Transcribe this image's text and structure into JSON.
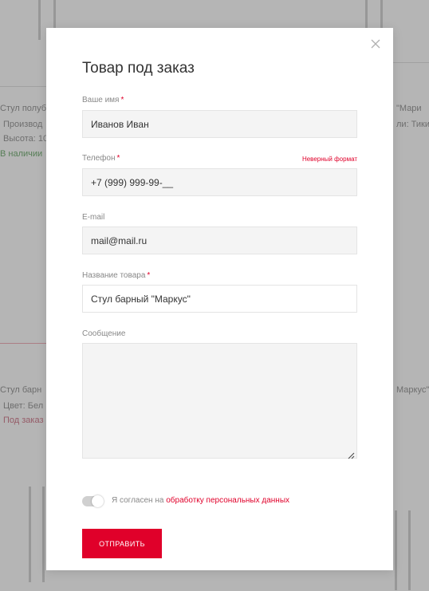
{
  "modal": {
    "title": "Товар под заказ",
    "submit_label": "ОТПРАВИТЬ"
  },
  "form": {
    "name": {
      "label": "Ваше имя",
      "required_mark": "*",
      "value": "Иванов Иван"
    },
    "phone": {
      "label": "Телефон",
      "required_mark": "*",
      "value": "+7 (999) 999-99-__",
      "error": "Неверный формат"
    },
    "email": {
      "label": "E-mail",
      "value": "mail@mail.ru"
    },
    "product": {
      "label": "Название товара",
      "required_mark": "*",
      "value": "Стул барный \"Маркус\""
    },
    "message": {
      "label": "Сообщение",
      "value": ""
    }
  },
  "consent": {
    "text": "Я согласен на",
    "link": "обработку персональных данных",
    "checked": true
  },
  "background": {
    "left_texts": [
      "Стул полубар",
      "Производ",
      "Высота: 10",
      "В наличии",
      "Стул барн",
      "Цвет: Бел",
      "Под заказ"
    ],
    "right_texts": [
      "\"Мари",
      "ли: Тики",
      "Маркус\""
    ]
  },
  "colors": {
    "accent": "#e0002a",
    "input_bg": "#f4f4f4",
    "label": "#888888"
  }
}
